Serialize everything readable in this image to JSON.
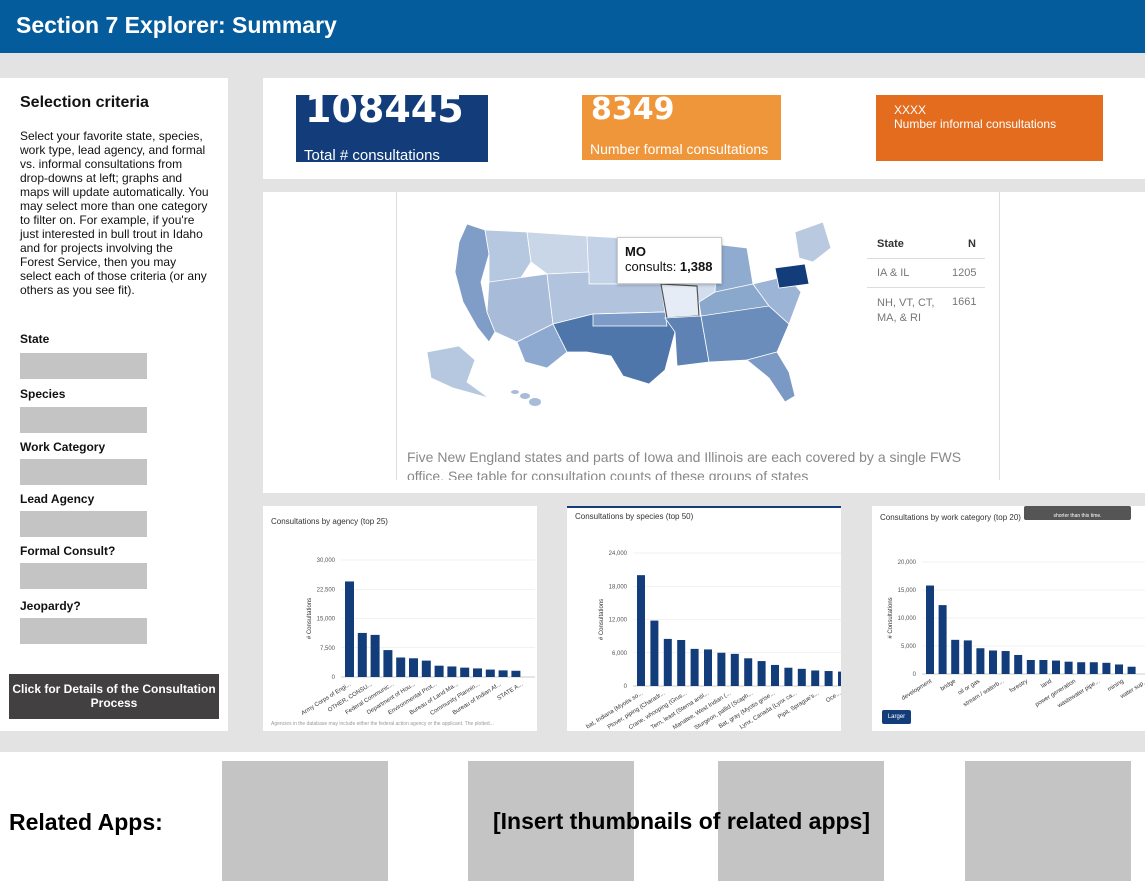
{
  "header": {
    "title": "Section 7 Explorer: Summary"
  },
  "sidebar": {
    "title": "Selection criteria",
    "intro": "Select your favorite state, species, work type, lead agency, and formal vs. informal consultations from drop-downs at left; graphs and maps will update automatically. You may select more than one category to filter on. For example, if you're just interested in bull trout in Idaho and for projects involving the Forest Service, then you may select each of those criteria (or any others as you see fit).",
    "criteria": [
      "State",
      "Species",
      "Work Category",
      "Lead Agency",
      "Formal Consult?",
      "Jeopardy?"
    ],
    "details_button": "Click for Details of the Consultation Process"
  },
  "stats": {
    "total_value": "108445",
    "total_label": "Total # consultations",
    "formal_value": "8349",
    "formal_label": "Number formal consultations",
    "informal_value": "XXXX",
    "informal_label": "Number informal consultations",
    "colors": {
      "total": "#123d7a",
      "formal": "#f0963a",
      "informal": "#e36c1f"
    }
  },
  "map": {
    "tooltip_state": "MO",
    "tooltip_prefix": "consults: ",
    "tooltip_value": "1,388",
    "table": {
      "headers": [
        "State",
        "N"
      ],
      "rows": [
        {
          "state": "IA & IL",
          "n": "1205"
        },
        {
          "state": "NH, VT, CT, MA, & RI",
          "n": "1661"
        }
      ]
    },
    "note": "Five New England states and parts of Iowa and Illinois are each covered by a single FWS office. See table for consultation counts of these groups of states"
  },
  "chart_data": [
    {
      "type": "bar",
      "title": "Consultations by agency (top 25)",
      "ylabel": "# Consultations",
      "ylim": [
        0,
        30000
      ],
      "yticks": [
        "30,000",
        "22,500",
        "15,000",
        "7,500",
        "0"
      ],
      "categories": [
        "Army Corps of Engi...",
        "OTHER, CONSU...",
        "Federal Communic...",
        "Department of Hou...",
        "Environmental Prot...",
        "Bureau of Land Ma...",
        "Community Plannin...",
        "Bureau of Indian Af...",
        "STATE A..."
      ],
      "values": [
        24500,
        11300,
        10800,
        6900,
        5000,
        4800,
        4200,
        2900,
        2700,
        2400,
        2200,
        1900,
        1700,
        1600
      ],
      "footnote": "Agencies in the database may include either the federal action agency or the applicant. The plotted..."
    },
    {
      "type": "bar",
      "title": "Consultations by species (top 50)",
      "ylabel": "# Consultations",
      "ylim": [
        0,
        24000
      ],
      "yticks": [
        "24,000",
        "18,000",
        "12,000",
        "6,000",
        "0"
      ],
      "categories": [
        "bat, Indiana (Myotis so...",
        "Plover, piping (Charadr...",
        "Crane, whooping (Grus...",
        "Tern, least (Sterna antil...",
        "Manatee, West Indian (...",
        "Sturgeon, pallid (Scaph...",
        "Bat, gray (Myotis grise...",
        "Lynx, Canada (Lynx ca...",
        "Pipit, Sprague's...",
        "Oce..."
      ],
      "values": [
        20000,
        11800,
        8500,
        8300,
        6700,
        6600,
        6000,
        5800,
        5000,
        4500,
        3800,
        3300,
        3100,
        2800,
        2700,
        2600
      ]
    },
    {
      "type": "bar",
      "title": "Consultations by work category (top 20)",
      "ylabel": "# Consultations",
      "ylim": [
        0,
        20000
      ],
      "yticks": [
        "20,000",
        "15,000",
        "10,000",
        "5,000",
        "0"
      ],
      "categories": [
        "development",
        "bridge",
        "oil or gas",
        "stream / waterb...",
        "forestry",
        "land",
        "power generation",
        "wastewater pipe...",
        "mining",
        "water sup..."
      ],
      "values": [
        15800,
        12300,
        6100,
        6000,
        4600,
        4200,
        4100,
        3400,
        2500,
        2500,
        2400,
        2200,
        2100,
        2100,
        2000,
        1700,
        1300
      ],
      "button": "Larger",
      "tooltip": "shorter than this time."
    }
  ],
  "related": {
    "title": "Related Apps:",
    "placeholder": "[Insert thumbnails of related apps]"
  }
}
